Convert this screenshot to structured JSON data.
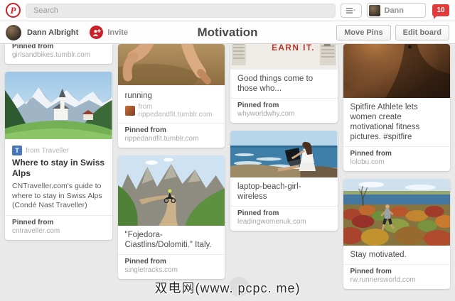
{
  "topbar": {
    "logo_letter": "P",
    "search_placeholder": "Search",
    "username": "Dann",
    "notification_count": "10"
  },
  "boardbar": {
    "owner_name": "Dann Albright",
    "invite_label": "Invite",
    "board_title": "Motivation",
    "move_pins_label": "Move Pins",
    "edit_board_label": "Edit board"
  },
  "pins": [
    {
      "pinned_label": "Pinned from",
      "domain": "girlsandbikes.tumblr.com"
    },
    {
      "attribution_icon": "T",
      "attribution": "from Traveller",
      "title": "Where to stay in Swiss Alps",
      "description": "CNTraveller.com's guide to where to stay in Swiss Alps (Condé Nast Traveller)",
      "pinned_label": "Pinned from",
      "domain": "cntraveller.com",
      "image": "swiss-alps-village"
    },
    {
      "title": "running",
      "attribution": "from rippedandfit.tumblr.com",
      "pinned_label": "Pinned from",
      "domain": "rippedandfit.tumblr.com",
      "image": "running-legs"
    },
    {
      "title": "\"Fojedora-Ciastlins/Dolomiti.\" Italy.",
      "pinned_label": "Pinned from",
      "domain": "singletracks.com",
      "image": "dolomites-mountain-biker"
    },
    {
      "title": "Good things come to those who...",
      "image_text": "EARN IT.",
      "pinned_label": "Pinned from",
      "domain": "whyworldwhy.com",
      "image": "earn-it-poster"
    },
    {
      "title": "laptop-beach-girl-wireless",
      "pinned_label": "Pinned from",
      "domain": "leadingwomenuk.com",
      "image": "woman-laptop-beach"
    },
    {
      "title": "Spitfire Athlete lets women create motivational fitness pictures. #spitfire",
      "pinned_label": "Pinned from",
      "domain": "lolobu.com",
      "image": "fitness-torso"
    },
    {
      "title": "Stay motivated.",
      "pinned_label": "Pinned from",
      "domain": "rw.runnersworld.com",
      "image": "autumn-trail-runner"
    }
  ],
  "colors": {
    "pinterest_red": "#cb2027",
    "badge_red": "#e13b3b",
    "background_gray": "#e9e9e9"
  },
  "watermark": "双电网(www. pcpc. me)"
}
